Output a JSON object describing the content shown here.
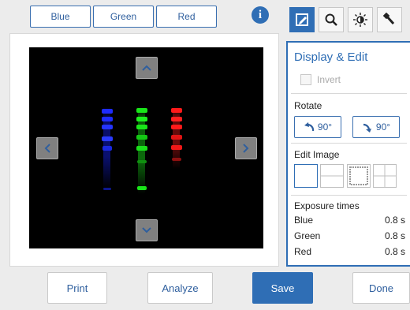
{
  "channels": [
    {
      "label": "Blue"
    },
    {
      "label": "Green"
    },
    {
      "label": "Red"
    }
  ],
  "info_icon": "i",
  "tools": [
    {
      "icon": "display-edit-icon",
      "active": true
    },
    {
      "icon": "zoom-icon",
      "active": false
    },
    {
      "icon": "brightness-icon",
      "active": false
    },
    {
      "icon": "pipette-icon",
      "active": false
    }
  ],
  "panel": {
    "title": "Display & Edit",
    "invert_label": "Invert",
    "invert_checked": false,
    "rotate_label": "Rotate",
    "rotate_left_label": "90°",
    "rotate_right_label": "90°",
    "edit_image_label": "Edit Image",
    "exposure_label": "Exposure times",
    "exposures": [
      {
        "channel": "Blue",
        "time": "0.8 s"
      },
      {
        "channel": "Green",
        "time": "0.8 s"
      },
      {
        "channel": "Red",
        "time": "0.8 s"
      }
    ]
  },
  "bottom": {
    "print_label": "Print",
    "analyze_label": "Analyze",
    "save_label": "Save",
    "done_label": "Done"
  },
  "colors": {
    "accent": "#2f6eb5",
    "blue_signal": "#1e2cff",
    "green_signal": "#19e619",
    "red_signal": "#ff1a1a"
  }
}
